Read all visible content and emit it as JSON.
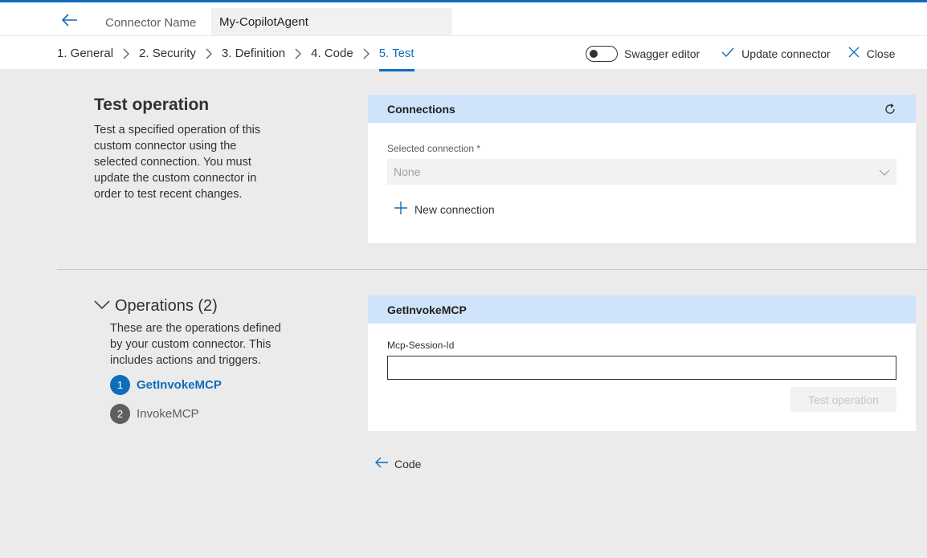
{
  "header": {
    "connector_name_label": "Connector Name",
    "connector_name_value": "My-CopilotAgent"
  },
  "steps": [
    {
      "label": "1. General"
    },
    {
      "label": "2. Security"
    },
    {
      "label": "3. Definition"
    },
    {
      "label": "4. Code"
    },
    {
      "label": "5. Test",
      "active": true
    }
  ],
  "toolbar": {
    "swagger_label": "Swagger editor",
    "update_label": "Update connector",
    "close_label": "Close"
  },
  "test_section": {
    "title": "Test operation",
    "description": "Test a specified operation of this custom connector using the selected connection. You must update the custom connector in order to test recent changes."
  },
  "connections": {
    "title": "Connections",
    "selected_label": "Selected connection *",
    "selected_value": "None",
    "new_connection_label": "New connection"
  },
  "operations": {
    "title": "Operations (2)",
    "description": "These are the operations defined by your custom connector. This includes actions and triggers.",
    "items": [
      {
        "num": "1",
        "label": "GetInvokeMCP"
      },
      {
        "num": "2",
        "label": "InvokeMCP"
      }
    ]
  },
  "operation_card": {
    "title": "GetInvokeMCP",
    "param_label": "Mcp-Session-Id",
    "param_value": "",
    "test_button_label": "Test operation"
  },
  "footer": {
    "code_link_label": "Code"
  },
  "colors": {
    "accent": "#0f6cbd",
    "card_header": "#cfe4fa",
    "background": "#ebebeb"
  }
}
